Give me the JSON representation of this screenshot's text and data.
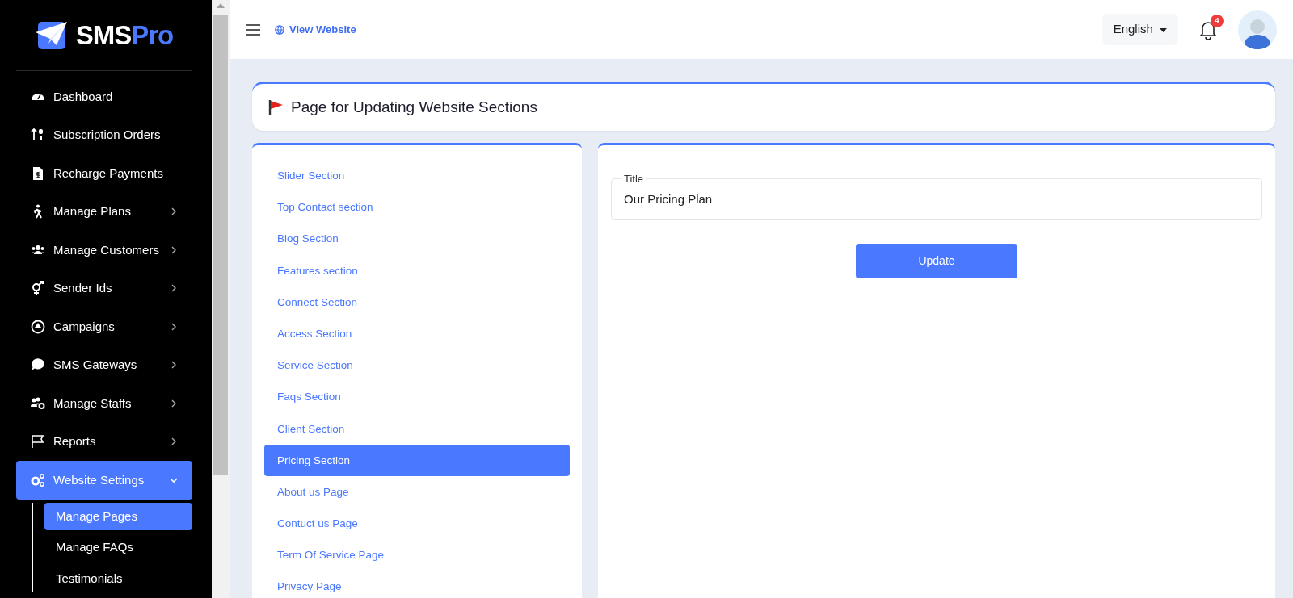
{
  "brand": {
    "name": "SMS",
    "accent": "Pro"
  },
  "sidebar": {
    "items": [
      {
        "label": "Dashboard",
        "selected": false
      },
      {
        "label": "Subscription Orders",
        "selected": false
      },
      {
        "label": "Recharge Payments",
        "selected": false
      },
      {
        "label": "Manage Plans",
        "expanded": false,
        "selected": false
      },
      {
        "label": "Manage Customers",
        "expanded": false,
        "selected": false
      },
      {
        "label": "Sender Ids",
        "expanded": false,
        "selected": false
      },
      {
        "label": "Campaigns",
        "expanded": false,
        "selected": false
      },
      {
        "label": "SMS Gateways",
        "expanded": false,
        "selected": false
      },
      {
        "label": "Manage Staffs",
        "expanded": false,
        "selected": false
      },
      {
        "label": "Reports",
        "expanded": false,
        "selected": false
      },
      {
        "label": "Website Settings",
        "expanded": true,
        "selected": true,
        "children": [
          {
            "label": "Manage Pages",
            "selected": true
          },
          {
            "label": "Manage FAQs",
            "selected": false
          },
          {
            "label": "Testimonials",
            "selected": false
          }
        ]
      }
    ]
  },
  "topbar": {
    "view_website": "View Website",
    "language": "English",
    "notification_count": "4"
  },
  "page_title": "Page for Updating Website Sections",
  "sections": [
    {
      "label": "Slider Section",
      "selected": false
    },
    {
      "label": "Top Contact section",
      "selected": false
    },
    {
      "label": "Blog Section",
      "selected": false
    },
    {
      "label": "Features section",
      "selected": false
    },
    {
      "label": "Connect Section",
      "selected": false
    },
    {
      "label": "Access Section",
      "selected": false
    },
    {
      "label": "Service Section",
      "selected": false
    },
    {
      "label": "Faqs Section",
      "selected": false
    },
    {
      "label": "Client Section",
      "selected": false
    },
    {
      "label": "Pricing Section",
      "selected": true
    },
    {
      "label": "About us Page",
      "selected": false
    },
    {
      "label": "Contuct us Page",
      "selected": false
    },
    {
      "label": "Term Of Service Page",
      "selected": false
    },
    {
      "label": "Privacy Page",
      "selected": false
    }
  ],
  "form": {
    "title_label": "Title",
    "title_value": "Our Pricing Plan",
    "submit": "Update"
  }
}
